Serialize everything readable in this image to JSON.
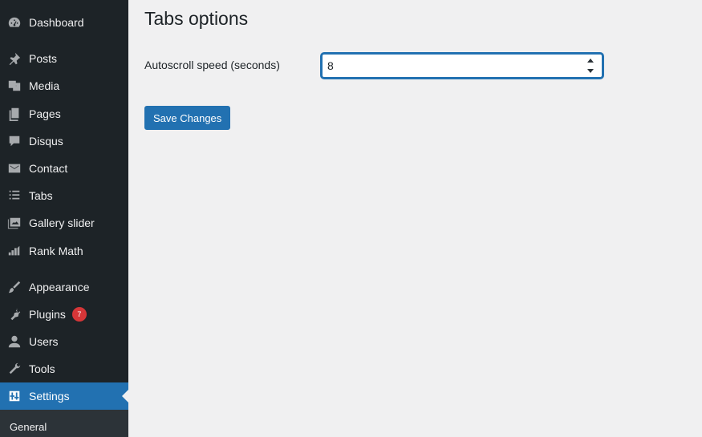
{
  "sidebar": {
    "items": [
      {
        "label": "Dashboard",
        "icon": "dashboard-icon"
      },
      {
        "label": "Posts",
        "icon": "pin-icon"
      },
      {
        "label": "Media",
        "icon": "media-icon"
      },
      {
        "label": "Pages",
        "icon": "pages-icon"
      },
      {
        "label": "Disqus",
        "icon": "comment-icon"
      },
      {
        "label": "Contact",
        "icon": "envelope-icon"
      },
      {
        "label": "Tabs",
        "icon": "list-icon"
      },
      {
        "label": "Gallery slider",
        "icon": "gallery-icon"
      },
      {
        "label": "Rank Math",
        "icon": "chart-icon"
      },
      {
        "label": "Appearance",
        "icon": "brush-icon"
      },
      {
        "label": "Plugins",
        "icon": "plug-icon",
        "badge": "7"
      },
      {
        "label": "Users",
        "icon": "user-icon"
      },
      {
        "label": "Tools",
        "icon": "wrench-icon"
      },
      {
        "label": "Settings",
        "icon": "settings-icon",
        "active": true
      }
    ],
    "submenu": {
      "general": "General"
    }
  },
  "main": {
    "title": "Tabs options",
    "field_label": "Autoscroll speed (seconds)",
    "speed_value": "8",
    "save_label": "Save Changes"
  },
  "colors": {
    "sidebar_bg": "#1d2327",
    "accent": "#2271b1",
    "badge": "#d63638",
    "page_bg": "#f0f0f1"
  }
}
